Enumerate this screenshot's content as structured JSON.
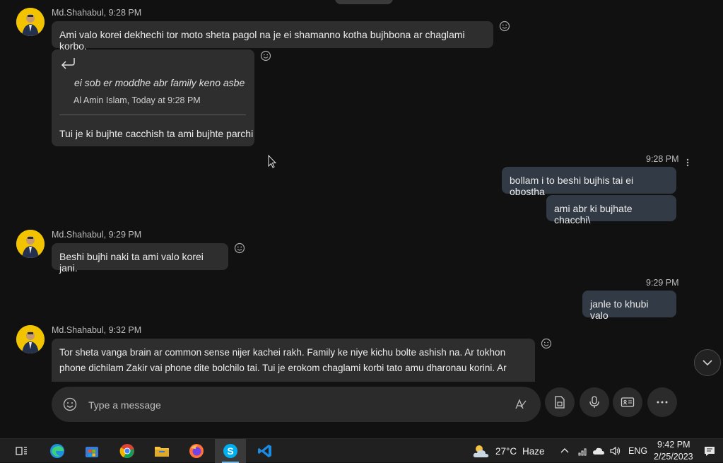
{
  "messages": {
    "m1": {
      "sender": "Md.Shahabul, 9:28 PM",
      "text": "Ami valo korei dekhechi tor moto sheta pagol na je ei shamanno kotha bujhbona ar chaglami korbo."
    },
    "m2": {
      "quote_text": "ei sob er moddhe abr family keno asbe",
      "quote_meta": "Al Amin Islam, Today at 9:28 PM",
      "text": "Tui je ki bujhte cacchish ta ami bujhte parchi"
    },
    "me1": {
      "time": "9:28 PM",
      "lines": [
        "bollam i to beshi bujhis tai ei obostha",
        "ami abr ki bujhate chacchi\\"
      ]
    },
    "m3": {
      "sender": "Md.Shahabul, 9:29 PM",
      "text": "Beshi bujhi naki ta ami valo korei jani."
    },
    "me2": {
      "time": "9:29 PM",
      "text": "janle to khubi valo"
    },
    "m4": {
      "sender": "Md.Shahabul, 9:32 PM",
      "line1": "Tor sheta vanga brain ar common sense nijer kachei rakh. Family ke niye kichu bolte ashish na. Ar tokhon",
      "line2": "phone dichilam Zakir vai phone dite bolchilo tai. Tui je erokom chaglami korbi tato amu dharonau korini. Ar"
    }
  },
  "composer": {
    "placeholder": "Type a message"
  },
  "taskbar": {
    "apps": [
      "task-view",
      "edge",
      "store",
      "chrome",
      "file-explorer",
      "firefox",
      "skype",
      "vscode"
    ],
    "active_app": "skype",
    "weather_temp": "27°C",
    "weather_desc": "Haze",
    "language": "ENG",
    "time": "9:42 PM",
    "date": "2/25/2023"
  },
  "colors": {
    "background": "#111111",
    "bubble_other": "#2e2e2e",
    "bubble_me": "#323a45",
    "avatar_bg": "#f2c400",
    "skype_blue": "#00aff0"
  }
}
